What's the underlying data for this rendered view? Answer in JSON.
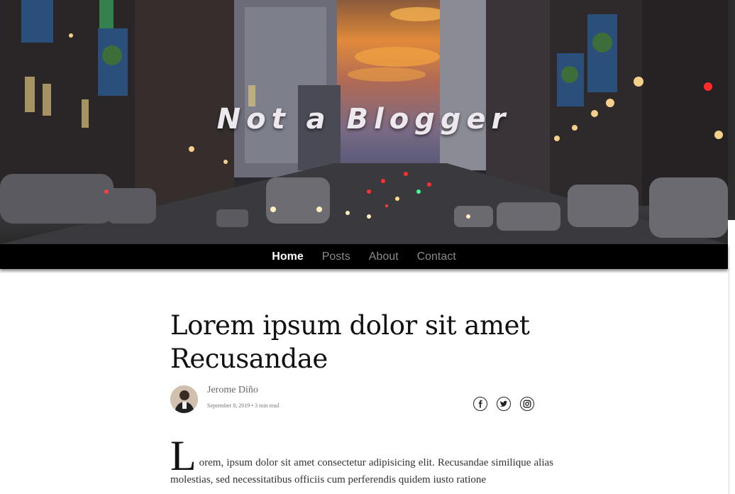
{
  "site": {
    "title": "Not a Blogger"
  },
  "nav": {
    "items": [
      "Home",
      "Posts",
      "About",
      "Contact"
    ],
    "active": "Home"
  },
  "post": {
    "title_line1": "Lorem ipsum dolor sit amet",
    "title_line2": "Recusandae",
    "author": "Jerome Diño",
    "meta": "September 8, 2019 • 3 min read",
    "dropcap": "L",
    "body": "orem, ipsum dolor sit amet consectetur adipisicing elit. Recusandae similique alias molestias, sed necessitatibus officiis cum perferendis quidem iusto ratione"
  },
  "social": {
    "icons": [
      "facebook-icon",
      "twitter-icon",
      "instagram-icon"
    ]
  },
  "colors": {
    "nav_bg": "#000000",
    "nav_active": "#ffffff",
    "nav_inactive": "#8a8a8a"
  }
}
